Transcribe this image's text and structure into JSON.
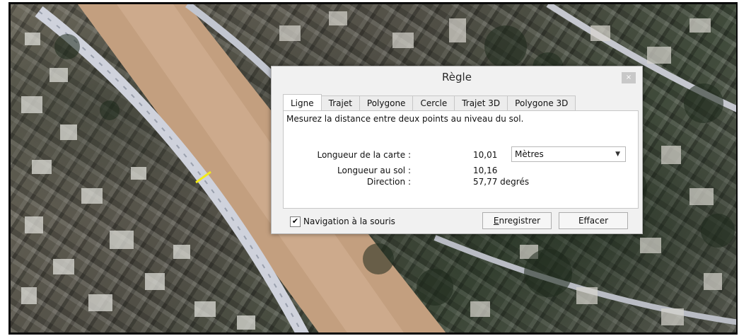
{
  "dialog": {
    "title": "Règle",
    "close_glyph": "×",
    "tabs": [
      {
        "label": "Ligne",
        "active": true
      },
      {
        "label": "Trajet",
        "active": false
      },
      {
        "label": "Polygone",
        "active": false
      },
      {
        "label": "Cercle",
        "active": false
      },
      {
        "label": "Trajet 3D",
        "active": false
      },
      {
        "label": "Polygone 3D",
        "active": false
      }
    ],
    "description": "Mesurez la distance entre deux points au niveau du sol.",
    "map_length": {
      "label": "Longueur de la carte :",
      "value": "10,01"
    },
    "ground_length": {
      "label": "Longueur au sol :",
      "value": "10,16"
    },
    "direction": {
      "label": "Direction :",
      "value": "57,77 degrés"
    },
    "unit_select": {
      "selected": "Mètres",
      "arrow": "▼"
    },
    "mouse_nav": {
      "label": "Navigation à la souris",
      "checked": true,
      "check_glyph": "✔"
    },
    "save_button": {
      "mnemonic": "E",
      "rest": "nregistrer"
    },
    "clear_button": "Effacer"
  },
  "colors": {
    "measure_line": "#f2ea1a",
    "road": "#c9ccd6",
    "dry_riverbed": "#c7a382"
  },
  "icons": [
    "close-icon",
    "checkbox-check-icon",
    "dropdown-arrow-icon"
  ]
}
